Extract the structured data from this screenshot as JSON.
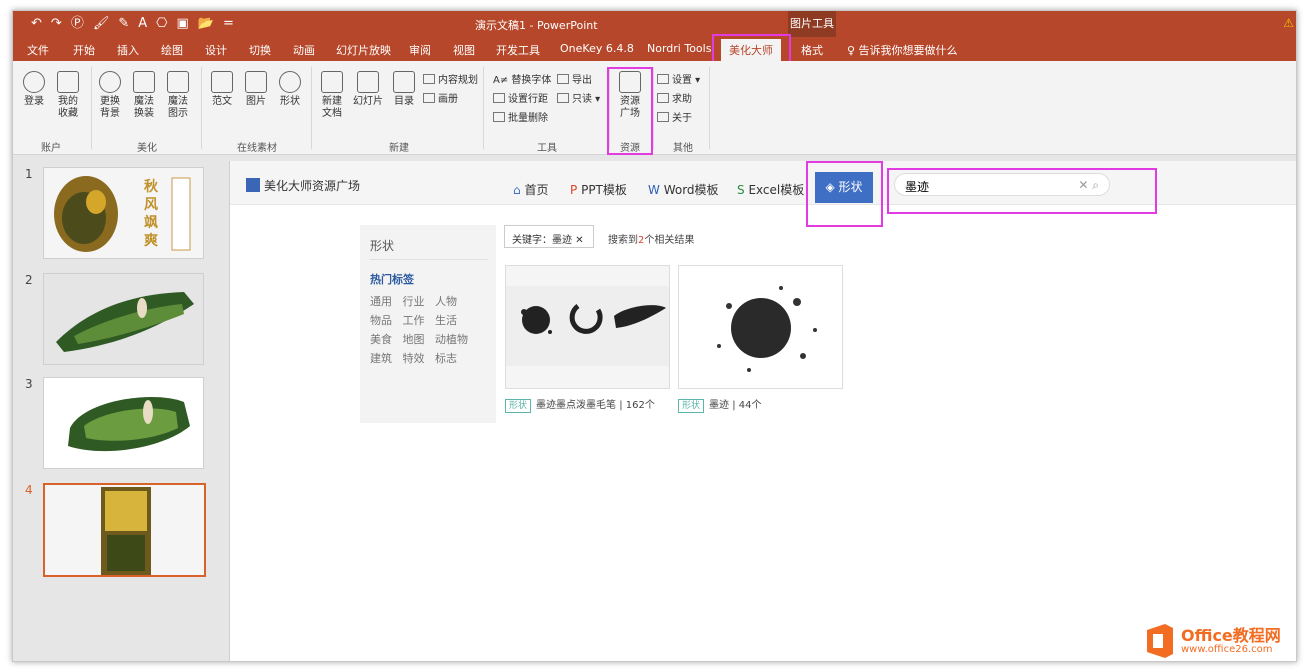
{
  "window": {
    "title": "演示文稿1 - PowerPoint",
    "context_group": "图片工具",
    "warning_icon": "warning-icon"
  },
  "qat": [
    "↶",
    "↷",
    "Ⓟ",
    "🖌",
    "✎",
    "A",
    "⎔",
    "▣",
    "📂",
    "="
  ],
  "tabs": [
    "文件",
    "开始",
    "插入",
    "绘图",
    "设计",
    "切换",
    "动画",
    "幻灯片放映",
    "审阅",
    "视图",
    "开发工具",
    "OneKey 6.4.8",
    "Nordri Tools",
    "美化大师",
    "格式"
  ],
  "tell_me": "♀ 告诉我你想要做什么",
  "ribbon": {
    "buttons": [
      {
        "label": "登录",
        "icon": "user-icon"
      },
      {
        "label": "我的\n收藏",
        "icon": "favorite-icon"
      },
      {
        "label": "更换\n背景",
        "icon": "refresh-icon"
      },
      {
        "label": "魔法\n换装",
        "icon": "magic-icon"
      },
      {
        "label": "魔法\n图示",
        "icon": "diagram-icon"
      },
      {
        "label": "范文",
        "icon": "template-icon"
      },
      {
        "label": "图片",
        "icon": "picture-icon"
      },
      {
        "label": "形状",
        "icon": "shape-icon"
      },
      {
        "label": "新建\n文档",
        "icon": "new-doc-icon"
      },
      {
        "label": "幻灯片",
        "icon": "slide-icon"
      },
      {
        "label": "目录",
        "icon": "list-icon"
      },
      {
        "label": "资源\n广场",
        "icon": "grid-icon"
      }
    ],
    "small": [
      "内容规划",
      "画册",
      "A≠ 替换字体",
      "导出",
      "设置行距",
      "只读 ▾",
      "批量删除",
      "设置 ▾",
      "求助",
      "关于"
    ],
    "groups": [
      "账户",
      "美化",
      "在线素材",
      "新建",
      "工具",
      "资源",
      "其他"
    ]
  },
  "slides": [
    "1",
    "2",
    "3",
    "4"
  ],
  "slide1_text": "秋\n风\n飒\n爽",
  "panel": {
    "site_title": "美化大师资源广场",
    "nav": [
      "首页",
      "PPT模板",
      "Word模板",
      "Excel模板"
    ],
    "shape_tab": "形状",
    "search_value": "墨迹",
    "search_clear": "✕",
    "filter_title": "形状",
    "hot_tags": "热门标签",
    "tag_rows": [
      "通用   行业   人物",
      "物品   工作   生活",
      "美食   地图   动植物",
      "建筑   特效   标志"
    ],
    "keyword_chip": "关键字：墨迹",
    "result_prefix": "搜索到",
    "result_count": "2",
    "result_suffix": "个相关结果",
    "results": [
      {
        "tag": "形状",
        "caption": "墨迹墨点泼墨毛笔 | 162个"
      },
      {
        "tag": "形状",
        "caption": "墨迹 | 44个"
      }
    ]
  },
  "watermark": {
    "brand": "Office教程网",
    "url": "www.office26.com"
  },
  "colors": {
    "ppt_red": "#b7472a",
    "highlight": "#e23be2",
    "blue": "#3f6fc4"
  }
}
